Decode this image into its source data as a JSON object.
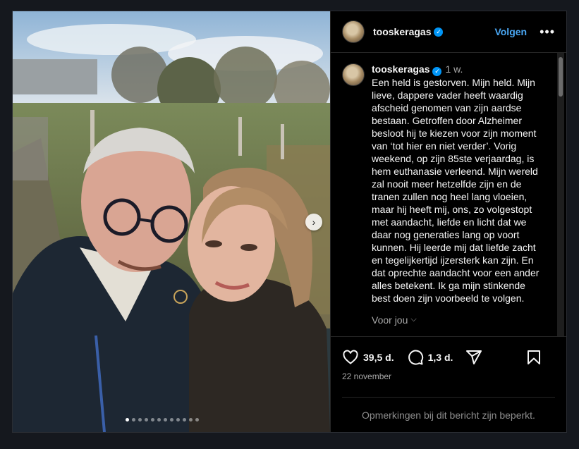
{
  "post": {
    "username": "tooskeragas",
    "follow_label": "Volgen",
    "more_label": "•••",
    "time_ago": "1 w.",
    "caption": "Een held is gestorven. Mijn held. Mijn\nlieve, dappere vader heeft waardig\nafscheid genomen van zijn aardse\nbestaan. Getroffen door Alzheimer\nbesloot hij te kiezen voor zijn moment\nvan ‘tot hier en niet verder’. Vorig\nweekend, op zijn 85ste verjaardag, is\nhem euthanasie verleend. Mijn wereld\nzal nooit meer hetzelfde zijn en de\ntranen zullen nog heel lang vloeien,\nmaar hij heeft mij, ons, zo volgestopt\nmet aandacht, liefde en licht dat we\ndaar nog generaties lang op voort\nkunnen. Hij leerde mij dat liefde zacht\nen tegelijkertijd ijzersterk kan zijn. En\ndat oprechte aandacht voor een ander\nalles betekent. Ik ga mijn stinkende\nbest doen zijn voorbeeld te volgen.",
    "translate_label": "Voor jou",
    "likes": "39,5 d.",
    "comments": "1,3 d.",
    "date": "22 november",
    "comments_limited": "Opmerkingen bij dit bericht zijn beperkt.",
    "carousel": {
      "total": 12,
      "active_index": 1
    }
  },
  "colors": {
    "accent": "#0095f6",
    "follow": "#4aa8f5",
    "background": "#000000"
  }
}
